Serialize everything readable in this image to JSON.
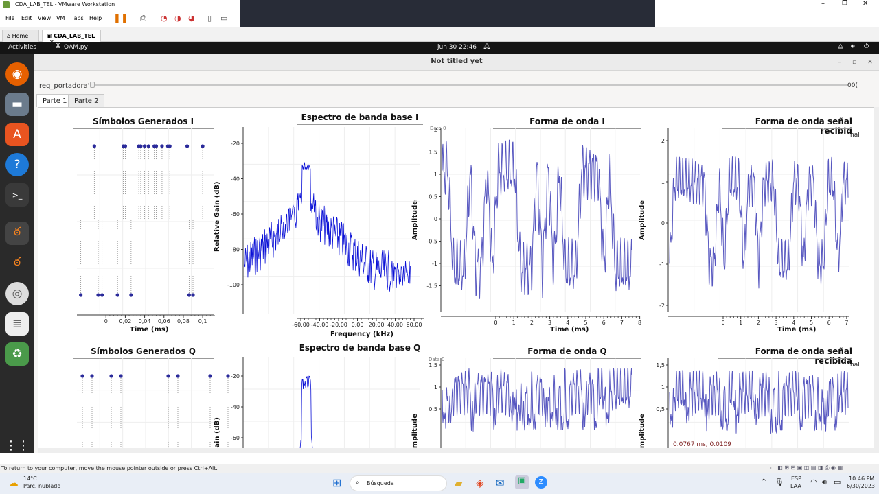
{
  "vmware": {
    "title": "CDA_LAB_TEL - VMware Workstation",
    "menu": [
      "File",
      "Edit",
      "View",
      "VM",
      "Tabs",
      "Help"
    ],
    "tabs": [
      "Home",
      "CDA_LAB_TEL"
    ],
    "status_message": "To return to your computer, move the mouse pointer outside or press Ctrl+Alt."
  },
  "gnome": {
    "activities": "Activities",
    "app_name": "QAM.py",
    "clock": "jun 30  22:46"
  },
  "app": {
    "window_title": "Not titled yet",
    "slider_label": "req_portadora'",
    "slider_value": "00(",
    "tabs": [
      "Parte 1",
      "Parte 2"
    ],
    "charts": {
      "sym_i_title": "Símbolos Generados I",
      "sym_q_title": "Símbolos Generados Q",
      "spec_i_title": "Espectro de banda base I",
      "spec_q_title": "Espectro de banda base Q",
      "wave_i_title": "Forma de onda I",
      "wave_q_title": "Forma de onda Q",
      "rx_i_title": "Forma de onda señal recibid",
      "rx_q_title": "Forma de onda señal recibida",
      "time_label": "Time (ms)",
      "freq_label": "Frequency (kHz)",
      "gain_label": "Relative Gain (dB)",
      "gain_label_cut": "Gain (dB)",
      "amplitude_label": "Amplitude",
      "legend_cut": "nal",
      "legend_cut_top": "Data 0",
      "cursor_readout": "0.0767 ms, 0.0109"
    }
  },
  "chart_data": [
    {
      "type": "scatter",
      "title": "Símbolos Generados I",
      "xlabel": "Time (ms)",
      "x_ticks": [
        "0",
        "0,02",
        "0,04",
        "0,06",
        "0,08",
        "0,1"
      ],
      "x": [
        -0.026,
        -0.012,
        -0.008,
        -0.004,
        0.012,
        0.018,
        0.02,
        0.026,
        0.036,
        0.034,
        0.04,
        0.044,
        0.05,
        0.052,
        0.058,
        0.064,
        0.066,
        0.084,
        0.086,
        0.09,
        0.1
      ],
      "y": [
        -1,
        1,
        -1,
        -1,
        -1,
        1,
        1,
        -1,
        1,
        1,
        1,
        1,
        1,
        1,
        1,
        1,
        1,
        1,
        -1,
        -1,
        1
      ]
    },
    {
      "type": "line",
      "title": "Espectro de banda base I",
      "xlabel": "Frequency (kHz)",
      "ylabel": "Relative Gain (dB)",
      "x_ticks": [
        "-60.00",
        "-40.00",
        "-20.00",
        "0.00",
        "20.00",
        "40.00",
        "60.00"
      ],
      "y_ticks": [
        "-20",
        "-40",
        "-60",
        "-80",
        "-100"
      ],
      "ylim": [
        -110,
        -15
      ]
    },
    {
      "type": "line",
      "title": "Forma de onda I",
      "xlabel": "Time (ms)",
      "ylabel": "Amplitude",
      "x_ticks": [
        "0",
        "1",
        "2",
        "3",
        "4",
        "5",
        "6",
        "7",
        "8"
      ],
      "y_ticks": [
        "2",
        "1,5",
        "1",
        "0,5",
        "0",
        "-0,5",
        "-1",
        "-1,5"
      ],
      "ylim": [
        -1.9,
        2
      ]
    },
    {
      "type": "line",
      "title": "Forma de onda señal recibid",
      "xlabel": "Time (ms)",
      "ylabel": "Amplitude",
      "x_ticks": [
        "0",
        "1",
        "2",
        "3",
        "4",
        "5",
        "6",
        "7"
      ],
      "y_ticks": [
        "2",
        "1",
        "0",
        "-1",
        "-2"
      ],
      "ylim": [
        -2.1,
        2.2
      ]
    },
    {
      "type": "scatter",
      "title": "Símbolos Generados Q",
      "x_ticks": [],
      "y": [
        1,
        1,
        1,
        1,
        1,
        1,
        1,
        1,
        1
      ]
    },
    {
      "type": "line",
      "title": "Espectro de banda base Q",
      "ylabel": "Gain (dB)",
      "y_ticks": [
        "-20",
        "-40",
        "-60"
      ]
    },
    {
      "type": "line",
      "title": "Forma de onda Q",
      "ylabel": "Amplitude",
      "y_ticks": [
        "1,5",
        "1",
        "0,5"
      ]
    },
    {
      "type": "line",
      "title": "Forma de onda señal recibida",
      "ylabel": "Amplitude",
      "y_ticks": [
        "1,5",
        "1",
        "0,5"
      ]
    }
  ],
  "taskbar": {
    "weather_temp": "14°C",
    "weather_desc": "Parc. nublado",
    "search": "Búsqueda",
    "lang": "ESP",
    "lang2": "LAA",
    "time": "10:46 PM",
    "date": "6/30/2023"
  },
  "colors": {
    "signal": "#5858c0",
    "spectrum": "#0a10d6",
    "symbol": "#2a2a9a"
  }
}
